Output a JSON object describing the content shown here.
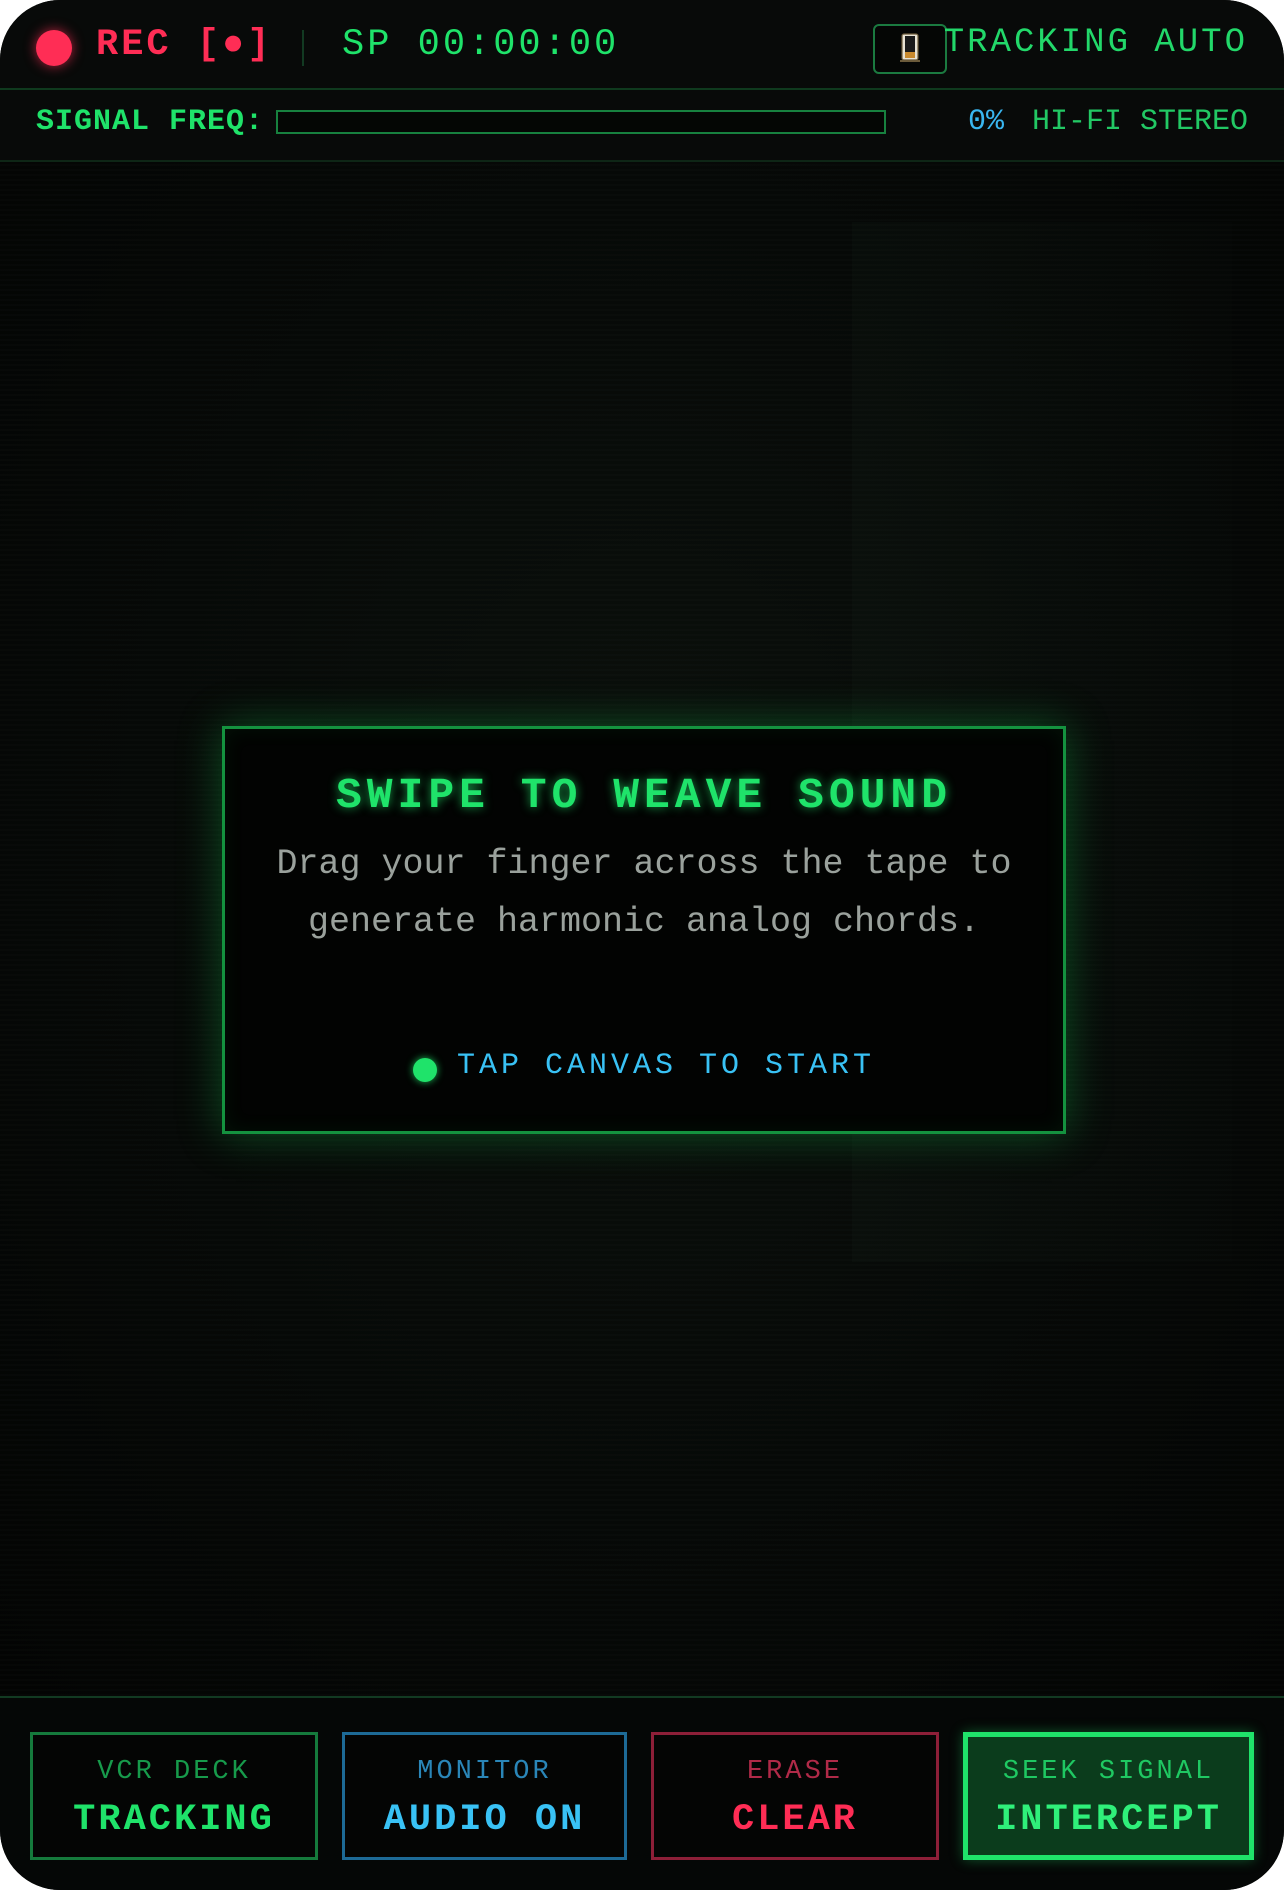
{
  "header": {
    "rec_label": "REC [●]",
    "timecode": "SP 00:00:00",
    "tracking_label": "TRACKING AUTO",
    "cassette_icon": "cassette-icon"
  },
  "signal": {
    "label": "SIGNAL FREQ:",
    "level_percent": 0,
    "percent_text": "0%",
    "mode": "HI-FI STEREO"
  },
  "modal": {
    "title": "SWIPE TO WEAVE SOUND",
    "body": "Drag your finger across the tape to generate harmonic analog chords.",
    "cta": "TAP CANVAS TO START"
  },
  "controls": [
    {
      "sub": "VCR DECK",
      "main": "TRACKING"
    },
    {
      "sub": "MONITOR",
      "main": "AUDIO ON"
    },
    {
      "sub": "ERASE",
      "main": "CLEAR"
    },
    {
      "sub": "SEEK SIGNAL",
      "main": "INTERCEPT"
    }
  ],
  "colors": {
    "accent_green": "#1fe36a",
    "accent_blue": "#39c2f5",
    "accent_red": "#ff2d55",
    "background": "#060807"
  }
}
